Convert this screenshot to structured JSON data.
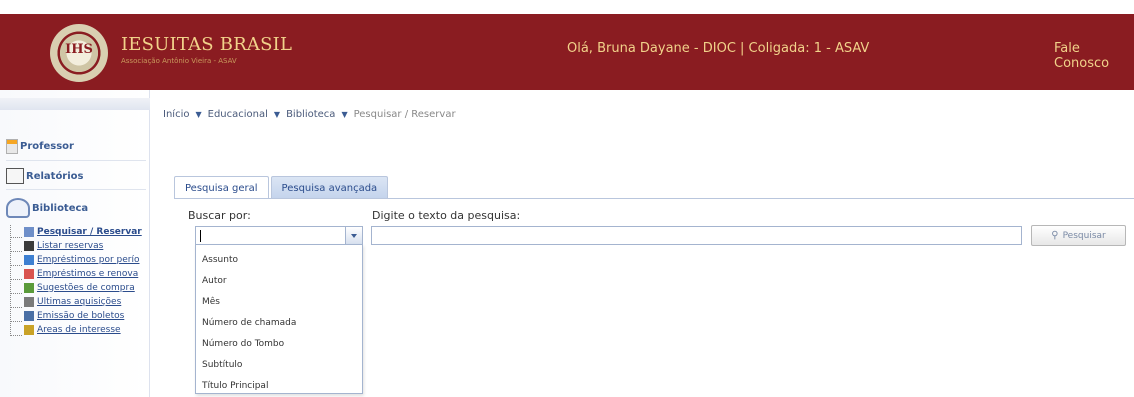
{
  "header": {
    "emblem_text": "IHS",
    "logo_title": "IESUITAS BRASIL",
    "logo_subtitle": "Associação Antônio Vieira - ASAV",
    "greeting": "Olá, Bruna Dayane - DIOC  |  Coligada: 1 - ASAV",
    "contact_link": "Fale Conosco",
    "colors": {
      "bar": "#8a1c21",
      "text": "#f1d28a"
    }
  },
  "sidebar": {
    "sections": [
      {
        "label": "Professor",
        "icon": "professor-icon"
      },
      {
        "label": "Relatórios",
        "icon": "reports-icon"
      },
      {
        "label": "Biblioteca",
        "icon": "library-icon"
      }
    ],
    "items": [
      {
        "label": "Pesquisar / Reservar",
        "icon": "search-book-icon",
        "color": "#6f8fc9"
      },
      {
        "label": "Listar reservas",
        "icon": "list-icon",
        "color": "#3b3b3b"
      },
      {
        "label": "Empréstimos por perío",
        "icon": "calendar-icon",
        "color": "#3d7fd1"
      },
      {
        "label": "Empréstimos e renova",
        "icon": "calendar-refresh-icon",
        "color": "#d9534f"
      },
      {
        "label": "Sugestões de compra",
        "icon": "suggestion-icon",
        "color": "#5a9a3a"
      },
      {
        "label": "Últimas aquisições",
        "icon": "new-items-icon",
        "color": "#7a7a7a"
      },
      {
        "label": "Emissão de boletos",
        "icon": "invoice-icon",
        "color": "#4a6fa5"
      },
      {
        "label": "Áreas de interesse",
        "icon": "interest-icon",
        "color": "#c9a227"
      }
    ]
  },
  "breadcrumb": [
    "Início",
    "Educacional",
    "Biblioteca",
    "Pesquisar / Reservar"
  ],
  "tabs": [
    "Pesquisa geral",
    "Pesquisa avançada"
  ],
  "search": {
    "buscar_label": "Buscar por:",
    "texto_label": "Digite o texto da pesquisa:",
    "buscar_value": "",
    "texto_value": "",
    "button_label": "Pesquisar"
  },
  "dropdown": {
    "options": [
      "Assunto",
      "Autor",
      "Mês",
      "Número de chamada",
      "Número do Tombo",
      "Subtítulo",
      "Título Principal"
    ]
  }
}
